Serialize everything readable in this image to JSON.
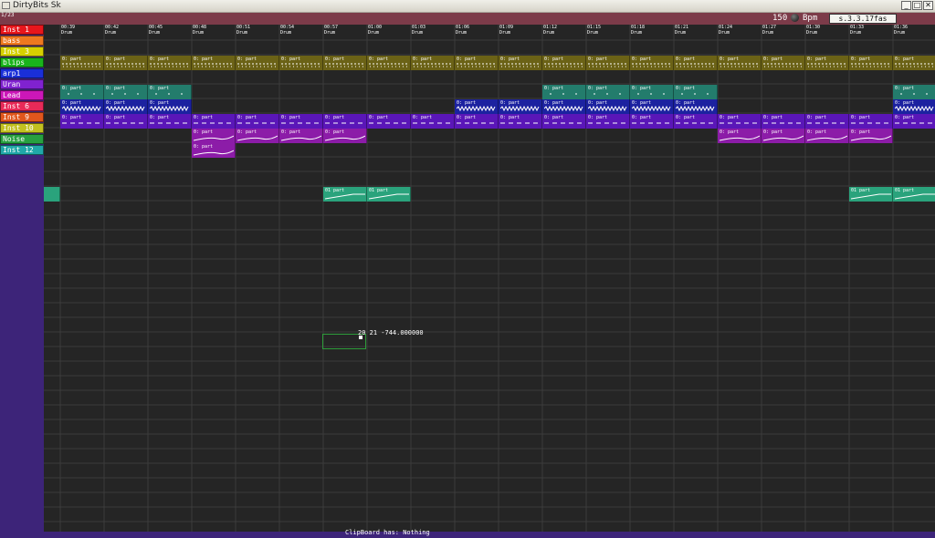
{
  "window": {
    "title": "DirtyBits Sk",
    "buttons": [
      "_",
      "□",
      "✕"
    ]
  },
  "toolbar": {
    "corner_label": "1/23",
    "bpm_value": "150",
    "bpm_label": "Bpm",
    "version": "s.3.3.17fas"
  },
  "tracks": [
    {
      "name": "Inst 1",
      "color": "#e8161c"
    },
    {
      "name": "bass",
      "color": "#ee7820"
    },
    {
      "name": "Inst 3",
      "color": "#d6d000"
    },
    {
      "name": "blips",
      "color": "#19b31b"
    },
    {
      "name": "arp1",
      "color": "#1a2fd8"
    },
    {
      "name": "Uran",
      "color": "#8022d0"
    },
    {
      "name": "Lead",
      "color": "#cc17b8"
    },
    {
      "name": "Inst 6",
      "color": "#e82a58"
    },
    {
      "name": "Inst 9",
      "color": "#e0561c"
    },
    {
      "name": "Inst 10",
      "color": "#c2c020"
    },
    {
      "name": "Noise",
      "color": "#27a040"
    },
    {
      "name": "Inst 12",
      "color": "#20a8a8"
    }
  ],
  "timeline": {
    "times": [
      "00:39",
      "00:42",
      "00:45",
      "00:48",
      "00:51",
      "00:54",
      "00:57",
      "01:00",
      "01:03",
      "01:06",
      "01:09",
      "01:12",
      "01:15",
      "01:18",
      "01:21",
      "01:24",
      "01:27",
      "01:30",
      "01:33",
      "01:36"
    ],
    "pattern_label": "Drum"
  },
  "clip_label": "0: part",
  "clip_label_alt": "01 part",
  "cursor_readout": "20  21  -744.000000",
  "status": {
    "text": "ClipBoard has: Nothing"
  },
  "colors": {
    "titlebar": "#e4e2da",
    "topbar": "#7c3b49",
    "sidebar": "#3d2479",
    "grid_bg": "#252525",
    "grid_line": "#3c3c3c",
    "row_olive": "#6b6216",
    "row_teal": "#237c6c",
    "row_blue": "#1c22a0",
    "row_violet": "#5a16b8",
    "row_purple": "#8c1ca8",
    "row_green": "#2aa37c"
  }
}
